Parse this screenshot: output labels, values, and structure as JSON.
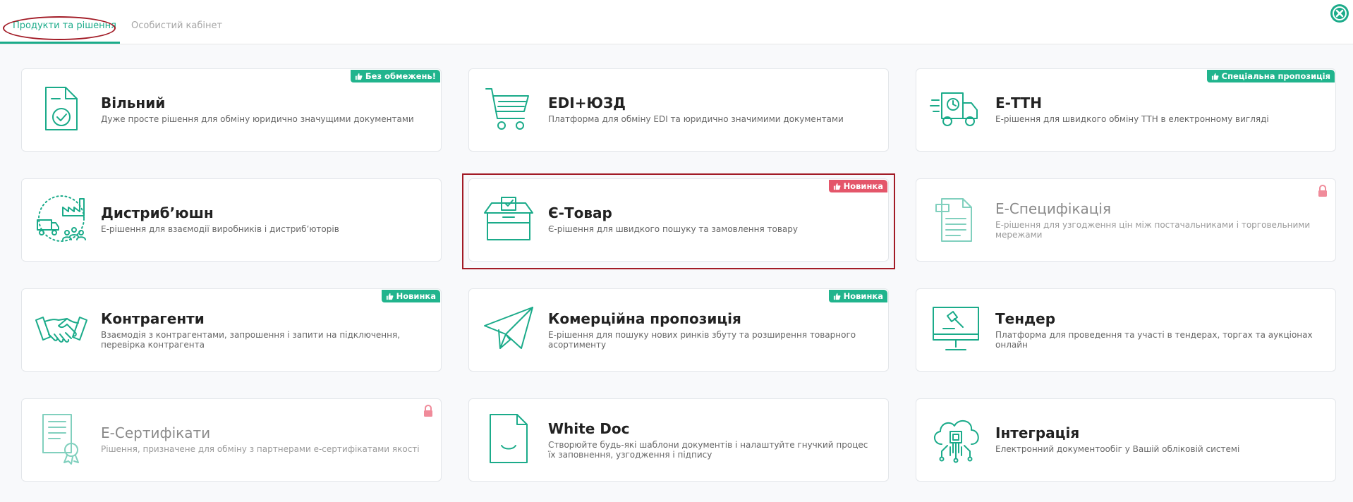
{
  "tabs": {
    "products": "Продукти та рішення",
    "cabinet": "Особистий кабінет"
  },
  "colors": {
    "accent": "#1bab8a",
    "badge_green": "#21b48d",
    "badge_red": "#e4566a",
    "highlight": "#a21b26"
  },
  "cards": [
    {
      "title": "Вільний",
      "desc": "Дуже просте рішення для обміну юридично значущими документами",
      "badge": "Без обмежень!",
      "icon": "document-check-icon"
    },
    {
      "title": "EDI+ЮЗД",
      "desc": "Платформа для обміну EDI та юридично значимими документами",
      "icon": "shopping-cart-icon"
    },
    {
      "title": "Е-ТТН",
      "desc": "Е-рішення для швидкого обміну ТТН в електронному вигляді",
      "badge": "Спеціальна пропозиція",
      "icon": "delivery-truck-icon"
    },
    {
      "title": "Дистриб’юшн",
      "desc": "Е-рішення для взаємодії виробників і дистриб’юторів",
      "icon": "distribution-icon"
    },
    {
      "title": "Є-Товар",
      "desc": "Є-рішення для швидкого пошуку та замовлення товару",
      "badge": "Новинка",
      "icon": "box-icon"
    },
    {
      "title": "Е-Специфікація",
      "desc": "Е-рішення для узгодження цін між постачальниками і торговельними мережами",
      "icon": "specification-icon"
    },
    {
      "title": "Контрагенти",
      "desc": "Взаємодія з контрагентами, запрошення і запити на підключення, перевірка контрагента",
      "badge": "Новинка",
      "icon": "handshake-icon"
    },
    {
      "title": "Комерційна пропозиція",
      "desc": "Е-рішення для пошуку нових ринків збуту та розширення товарного асортименту",
      "badge": "Новинка",
      "icon": "paper-plane-icon"
    },
    {
      "title": "Тендер",
      "desc": "Платформа для проведення та участі в тендерах, торгах та аукціонах онлайн",
      "icon": "auction-monitor-icon"
    },
    {
      "title": "Е-Сертифікати",
      "desc": "Рішення, призначене для обміну з партнерами е-сертифікатами якості",
      "icon": "certificate-icon"
    },
    {
      "title": "White Doc",
      "desc": "Створюйте будь-які шаблони документів і налаштуйте гнучкий процес їх заповнення, узгодження і підпису",
      "icon": "white-doc-icon"
    },
    {
      "title": "Інтеграція",
      "desc": "Електронний документообіг у Вашій обліковій системі",
      "icon": "cloud-chip-icon"
    }
  ]
}
